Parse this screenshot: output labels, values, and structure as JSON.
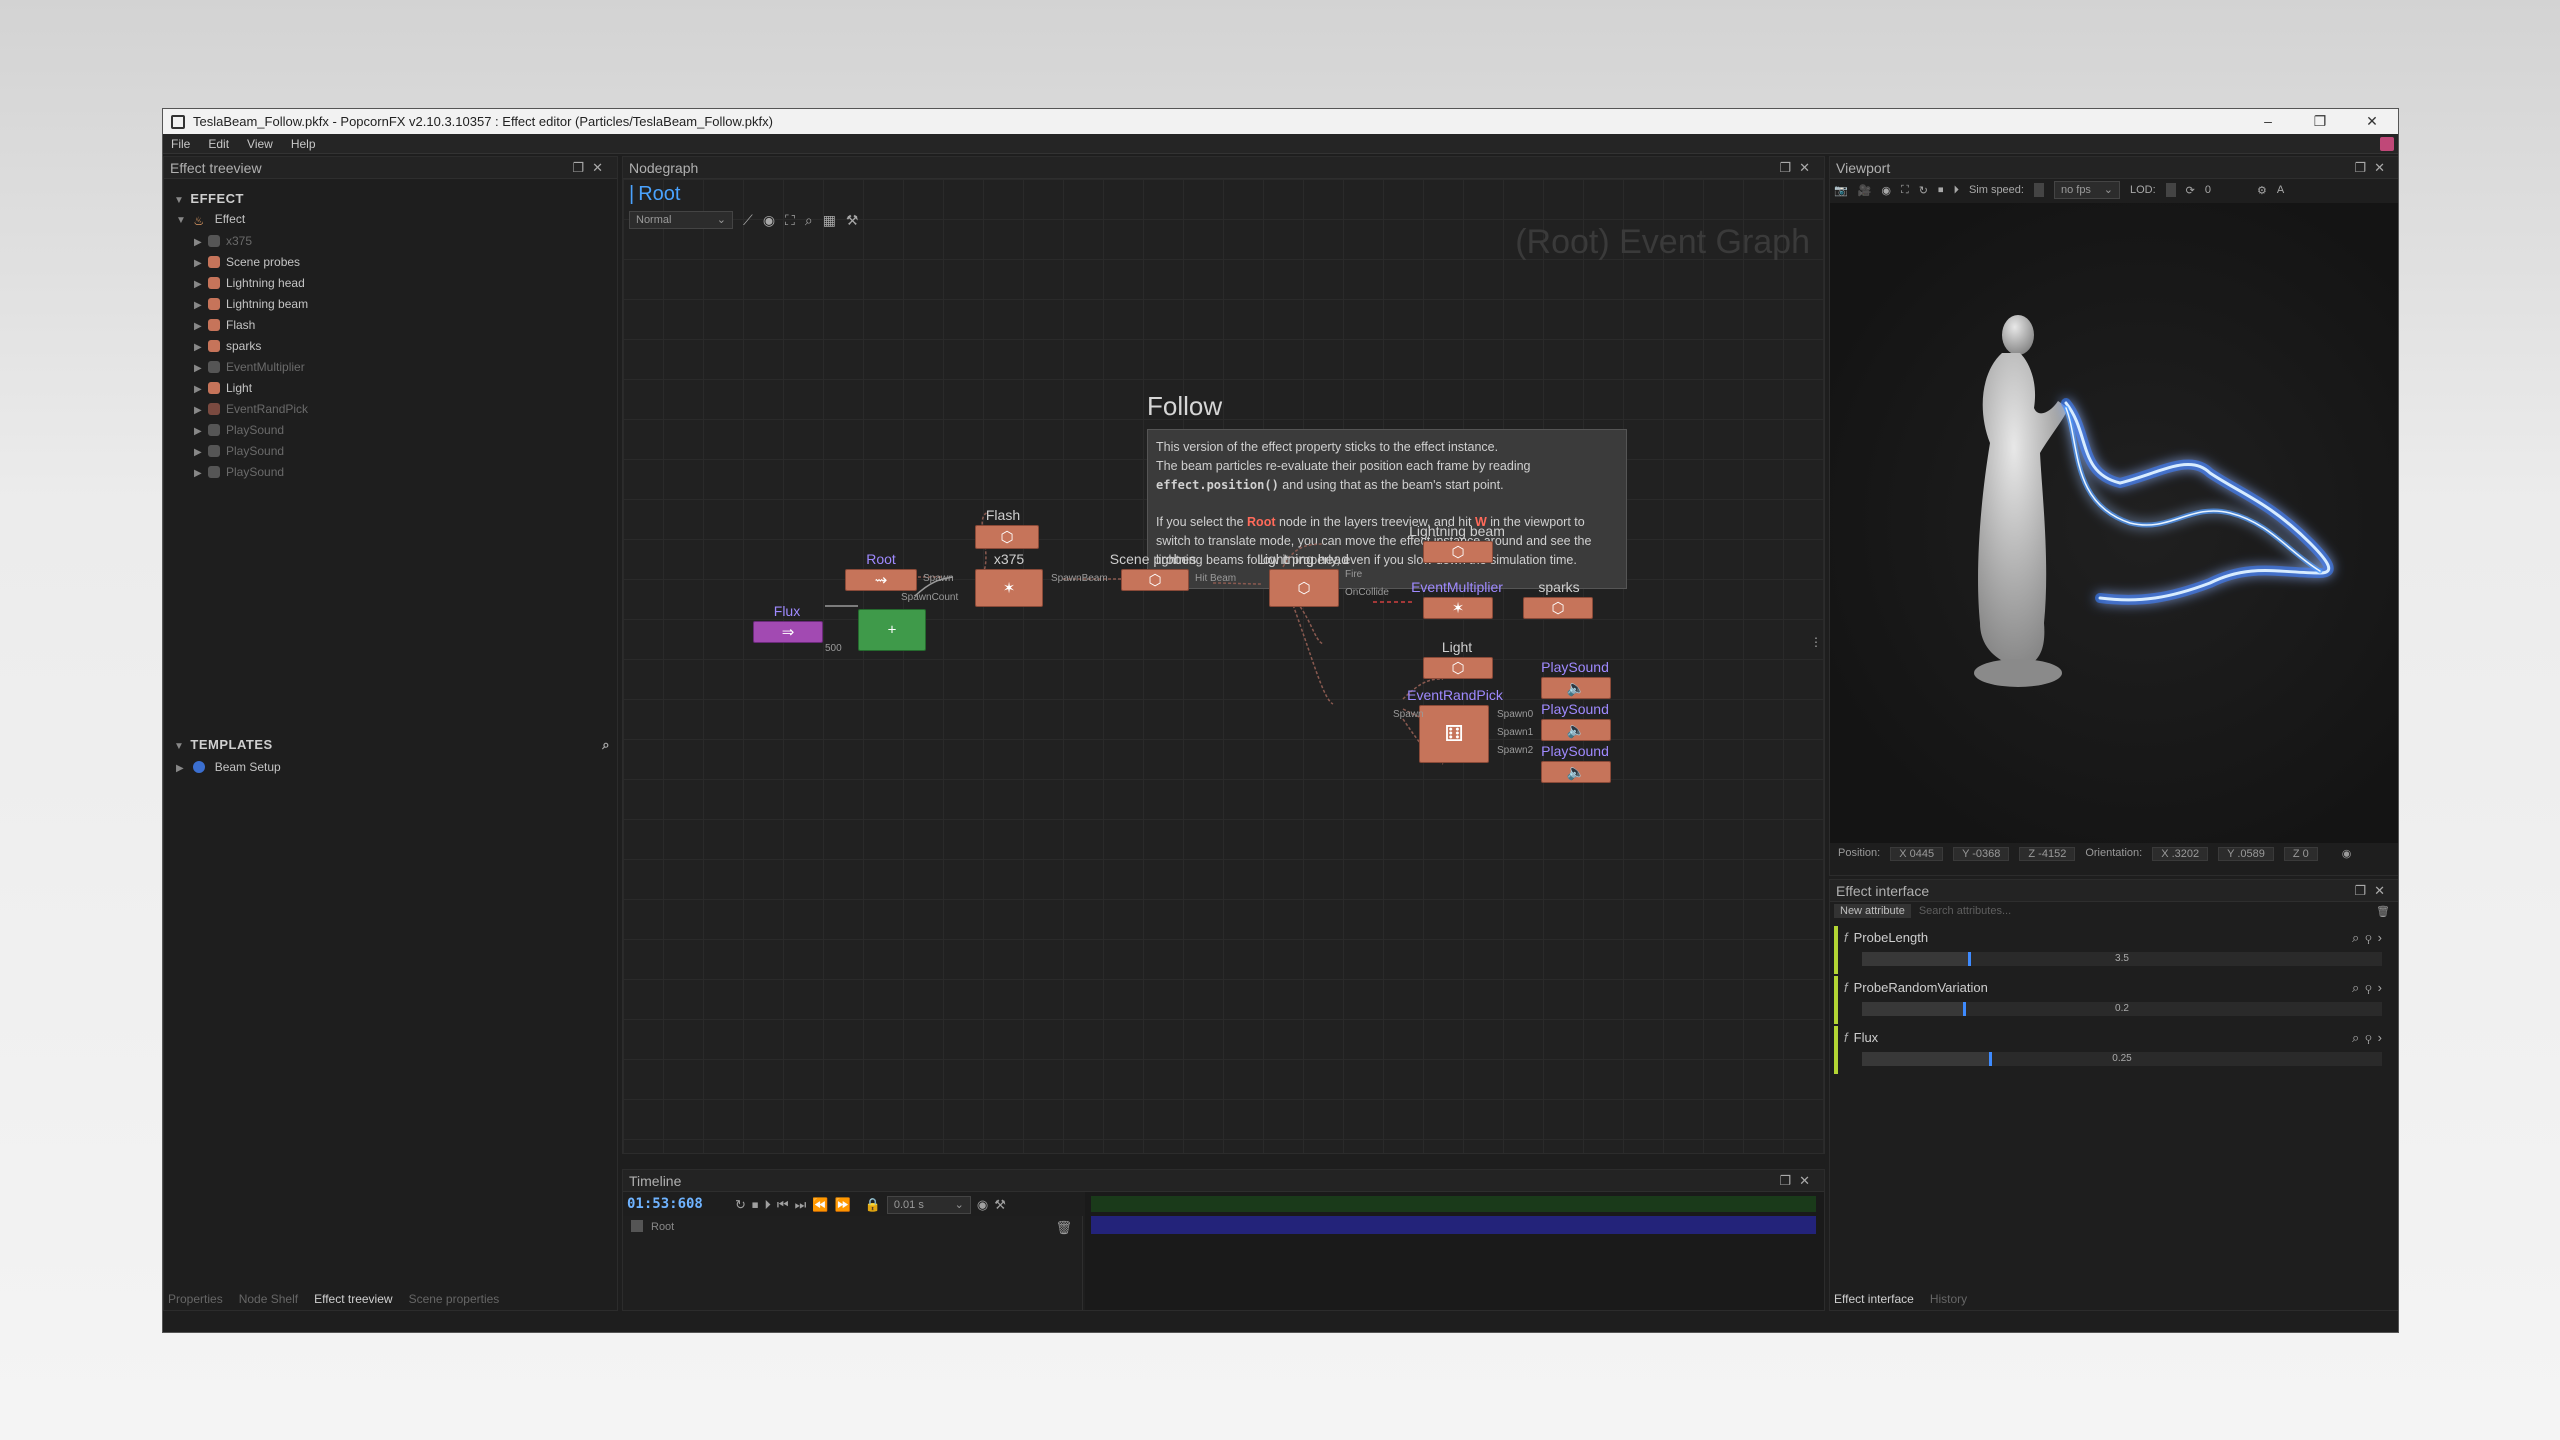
{
  "window": {
    "title": "TeslaBeam_Follow.pkfx - PopcornFX v2.10.3.10357 : Effect editor (Particles/TeslaBeam_Follow.pkfx)",
    "minimize": "–",
    "maximize": "❐",
    "close": "✕"
  },
  "menu": [
    "File",
    "Edit",
    "View",
    "Help"
  ],
  "treeview": {
    "title": "Effect treeview",
    "effect_section": "EFFECT",
    "root": "Effect",
    "items": [
      {
        "label": "x375",
        "dim": true,
        "color": "#555555"
      },
      {
        "label": "Scene probes",
        "dim": false,
        "color": "#c6745a"
      },
      {
        "label": "Lightning head",
        "dim": false,
        "color": "#c6745a"
      },
      {
        "label": "Lightning beam",
        "dim": false,
        "color": "#c6745a"
      },
      {
        "label": "Flash",
        "dim": false,
        "color": "#c6745a"
      },
      {
        "label": "sparks",
        "dim": false,
        "color": "#c6745a"
      },
      {
        "label": "EventMultiplier",
        "dim": true,
        "color": "#555555"
      },
      {
        "label": "Light",
        "dim": false,
        "color": "#c6745a"
      },
      {
        "label": "EventRandPick",
        "dim": true,
        "color": "#7a4a40"
      },
      {
        "label": "PlaySound",
        "dim": true,
        "color": "#555555"
      },
      {
        "label": "PlaySound",
        "dim": true,
        "color": "#555555"
      },
      {
        "label": "PlaySound",
        "dim": true,
        "color": "#555555"
      }
    ],
    "templates_section": "TEMPLATES",
    "templates": [
      "Beam Setup"
    ],
    "bottom_tabs": [
      "Properties",
      "Node Shelf",
      "Effect treeview",
      "Scene properties"
    ],
    "active_tab": "Effect treeview"
  },
  "nodegraph": {
    "title": "Nodegraph",
    "breadcrumb": "Root",
    "mode": "Normal",
    "watermark": "(Root) Event Graph",
    "comment_title": "Follow",
    "comment": {
      "line1": "This version of the effect property sticks to the effect instance.",
      "line2": "The beam particles re-evaluate their position each frame by reading",
      "code": "effect.position()",
      "line3": " and using that as the beam's start point.",
      "p2_a": "If you select the ",
      "p2_root": "Root",
      "p2_b": " node in the layers treeview, and hit ",
      "p2_w": "W",
      "p2_c": " in the viewport to switch to translate mode, you can move the effect instance around and see the lightning beams follow it properly, even if you slow down the simulation time."
    },
    "nodes": {
      "flash": "Flash",
      "root": "Root",
      "x375": "x375",
      "scene_probes": "Scene probes",
      "lightning_head": "Lightning head",
      "lightning_beam": "Lightning beam",
      "event_multiplier": "EventMultiplier",
      "sparks": "sparks",
      "light": "Light",
      "event_rand_pick": "EventRandPick",
      "flux": "Flux",
      "play_sound_1": "PlaySound",
      "play_sound_2": "PlaySound",
      "play_sound_3": "PlaySound"
    },
    "pins": {
      "spawn": "Spawn",
      "spawn_count": "SpawnCount",
      "spawn_beam": "SpawnBeam",
      "hit_beam": "Hit Beam",
      "fire": "Fire",
      "on_collide": "OnCollide",
      "spawn0": "Spawn0",
      "spawn1": "Spawn1",
      "spawn2": "Spawn2",
      "flux_value": "500"
    }
  },
  "viewport": {
    "title": "Viewport",
    "sim_speed_label": "Sim speed:",
    "fps": "no fps",
    "lod_label": "LOD:",
    "lod_value": "0",
    "status": {
      "position_label": "Position:",
      "px": "X  0445",
      "py": "Y  -0368",
      "pz": "Z  -4152",
      "orientation_label": "Orientation:",
      "ox": "X  .3202",
      "oy": "Y  .0589",
      "oz": "Z  0"
    }
  },
  "effect_interface": {
    "title": "Effect interface",
    "new_attribute": "New attribute",
    "search_placeholder": "Search attributes...",
    "attributes": [
      {
        "name": "ProbeLength",
        "value": "3.5",
        "fill": 0.21
      },
      {
        "name": "ProbeRandomVariation",
        "value": "0.2",
        "fill": 0.2
      },
      {
        "name": "Flux",
        "value": "0.25",
        "fill": 0.25
      }
    ],
    "bottom_tabs": [
      "Effect interface",
      "History"
    ],
    "accent": "#b4d634"
  },
  "timeline": {
    "title": "Timeline",
    "time": "01:53:608",
    "step": "0.01 s",
    "row_label": "Root"
  }
}
